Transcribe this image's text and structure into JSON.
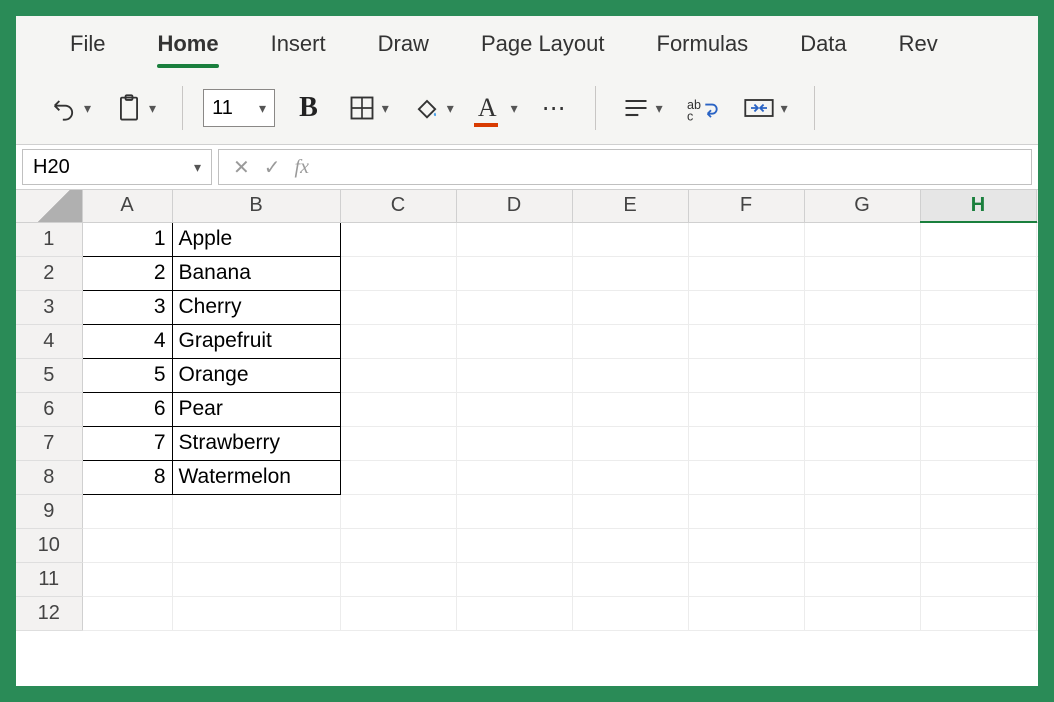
{
  "tabs": {
    "file": "File",
    "home": "Home",
    "insert": "Insert",
    "draw": "Draw",
    "page_layout": "Page Layout",
    "formulas": "Formulas",
    "data": "Data",
    "review": "Rev"
  },
  "toolbar": {
    "font_size": "11",
    "bold_label": "B",
    "more_label": "⋯"
  },
  "name_box": "H20",
  "formula_bar": {
    "cancel": "✕",
    "confirm": "✓",
    "fx": "fx",
    "value": ""
  },
  "columns": [
    "A",
    "B",
    "C",
    "D",
    "E",
    "F",
    "G",
    "H"
  ],
  "selected_column": "H",
  "rows": [
    "1",
    "2",
    "3",
    "4",
    "5",
    "6",
    "7",
    "8",
    "9",
    "10",
    "11",
    "12"
  ],
  "cells": {
    "A1": "1",
    "B1": "Apple",
    "A2": "2",
    "B2": "Banana",
    "A3": "3",
    "B3": "Cherry",
    "A4": "4",
    "B4": "Grapefruit",
    "A5": "5",
    "B5": "Orange",
    "A6": "6",
    "B6": "Pear",
    "A7": "7",
    "B7": "Strawberry",
    "A8": "8",
    "B8": "Watermelon"
  }
}
